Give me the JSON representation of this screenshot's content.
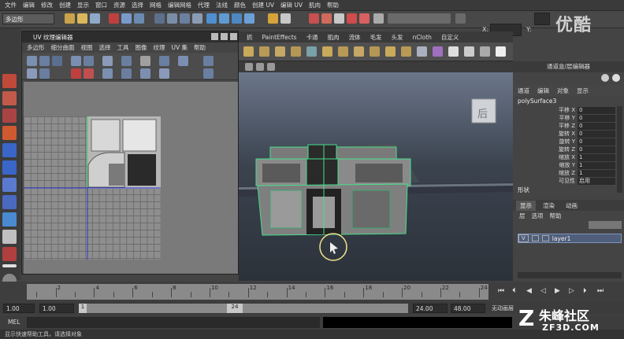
{
  "menubar": [
    "文件",
    "编辑",
    "修改",
    "创建",
    "显示",
    "窗口",
    "资源",
    "选择",
    "网格",
    "编辑网格",
    "代理",
    "法线",
    "颜色",
    "创建 UV",
    "编辑 UV",
    "肌肉",
    "帮助"
  ],
  "mode_select": "多边形",
  "coords": {
    "x_label": "X:",
    "y_label": "Y:"
  },
  "watermark_top": "优酷",
  "shelf_tabs": [
    "抓",
    "PaintEffects",
    "卡通",
    "肌肉",
    "流体",
    "毛发",
    "头发",
    "nCloth",
    "自定义"
  ],
  "uv_editor": {
    "title": "UV 纹理编辑器",
    "menu": [
      "多边形",
      "细分曲面",
      "视图",
      "选择",
      "工具",
      "图像",
      "纹理",
      "UV 集",
      "帮助"
    ]
  },
  "viewport": {
    "view_cube_label": "后"
  },
  "channel_box": {
    "header": "通道盒/层编辑器",
    "menu": [
      "通道",
      "编辑",
      "对象",
      "显示"
    ],
    "object": "polySurface3",
    "attributes": [
      {
        "label": "平移 X",
        "value": "0"
      },
      {
        "label": "平移 Y",
        "value": "0"
      },
      {
        "label": "平移 Z",
        "value": "0"
      },
      {
        "label": "旋转 X",
        "value": "0"
      },
      {
        "label": "旋转 Y",
        "value": "0"
      },
      {
        "label": "旋转 Z",
        "value": "0"
      },
      {
        "label": "缩放 X",
        "value": "1"
      },
      {
        "label": "缩放 Y",
        "value": "1"
      },
      {
        "label": "缩放 Z",
        "value": "1"
      },
      {
        "label": "可见性",
        "value": "启用"
      }
    ],
    "shapes_label": "形状",
    "layer_tabs": [
      "显示",
      "渲染",
      "动画"
    ],
    "layer_menu": [
      "层",
      "选项",
      "帮助"
    ],
    "layer": {
      "visible": "V",
      "name": "layer1"
    }
  },
  "timeline": {
    "ticks": [
      "2",
      "4",
      "6",
      "8",
      "10",
      "12",
      "14",
      "16",
      "18",
      "20",
      "22",
      "24"
    ]
  },
  "range": {
    "start": "1.00",
    "start2": "1.00",
    "slider_start": "1",
    "slider_end": "24",
    "end": "24.00",
    "end2": "48.00",
    "char_set": "无动画层"
  },
  "mel_label": "MEL",
  "help_line": "显示快速帮助工具，请选择对象",
  "watermark": {
    "brand": "朱峰社区",
    "url": "ZF3D.COM"
  }
}
